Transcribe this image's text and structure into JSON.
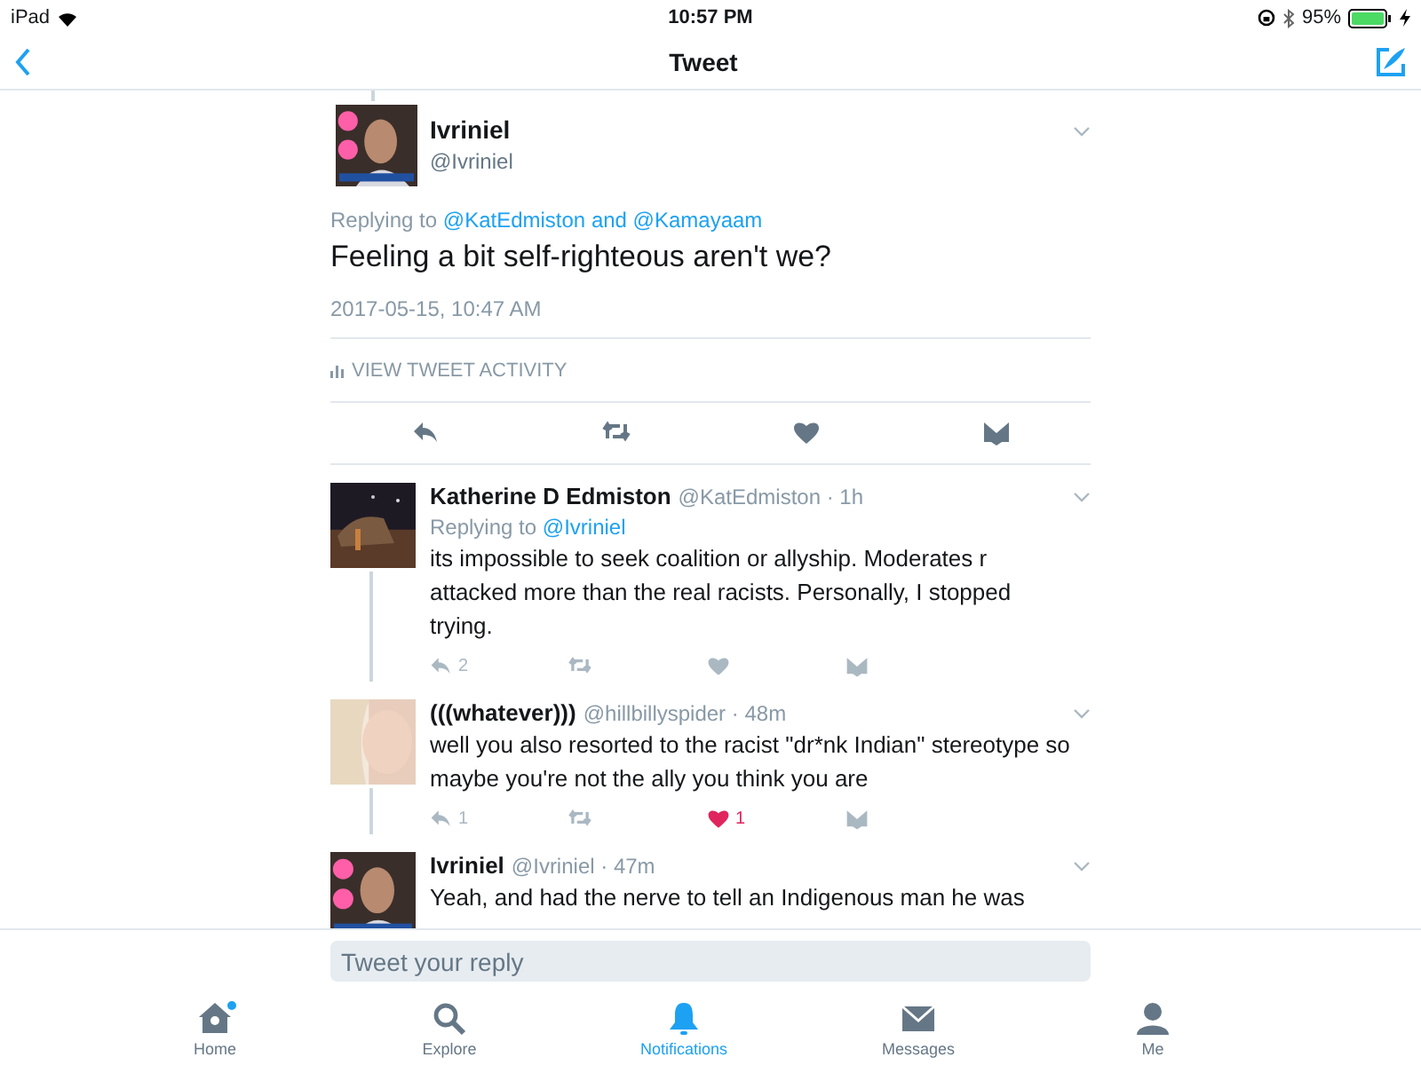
{
  "status_bar": {
    "device": "iPad",
    "time": "10:57 PM",
    "battery": "95%"
  },
  "nav": {
    "title": "Tweet"
  },
  "main_tweet": {
    "name": "Ivriniel",
    "handle": "@Ivriniel",
    "replying_label": "Replying to",
    "replying_to": "@KatEdmiston and @Kamayaam",
    "text": "Feeling a bit self-righteous aren't we?",
    "timestamp": "2017-05-15, 10:47 AM",
    "activity": "VIEW TWEET ACTIVITY"
  },
  "replies": [
    {
      "name": "Katherine D Edmiston",
      "meta": "@KatEdmiston · 1h",
      "replying_label": "Replying to",
      "replying_to": "@Ivriniel",
      "text": "its impossible to seek coalition or allyship. Moderates r attacked more than the real racists. Personally, I stopped trying.",
      "reply_count": "2",
      "liked": false,
      "thread_continues": true
    },
    {
      "name": "(((whatever)))",
      "meta": "@hillbillyspider · 48m",
      "text": "well you also resorted to the racist \"dr*nk Indian\" stereotype so maybe you're not the ally you think you are",
      "reply_count": "1",
      "like_count": "1",
      "liked": true,
      "thread_continues": true
    },
    {
      "name": "Ivriniel",
      "meta": "@Ivriniel · 47m",
      "text": "Yeah, and had the nerve to tell an Indigenous  man he was",
      "thread_continues": false
    }
  ],
  "reply_box": {
    "placeholder": "Tweet your reply"
  },
  "tabs": [
    {
      "label": "Home",
      "kind": "home",
      "selected": false,
      "badge": true
    },
    {
      "label": "Explore",
      "kind": "explore",
      "selected": false,
      "badge": false
    },
    {
      "label": "Notifications",
      "kind": "bell",
      "selected": true,
      "badge": false
    },
    {
      "label": "Messages",
      "kind": "mail",
      "selected": false,
      "badge": false
    },
    {
      "label": "Me",
      "kind": "person",
      "selected": false,
      "badge": false
    }
  ]
}
